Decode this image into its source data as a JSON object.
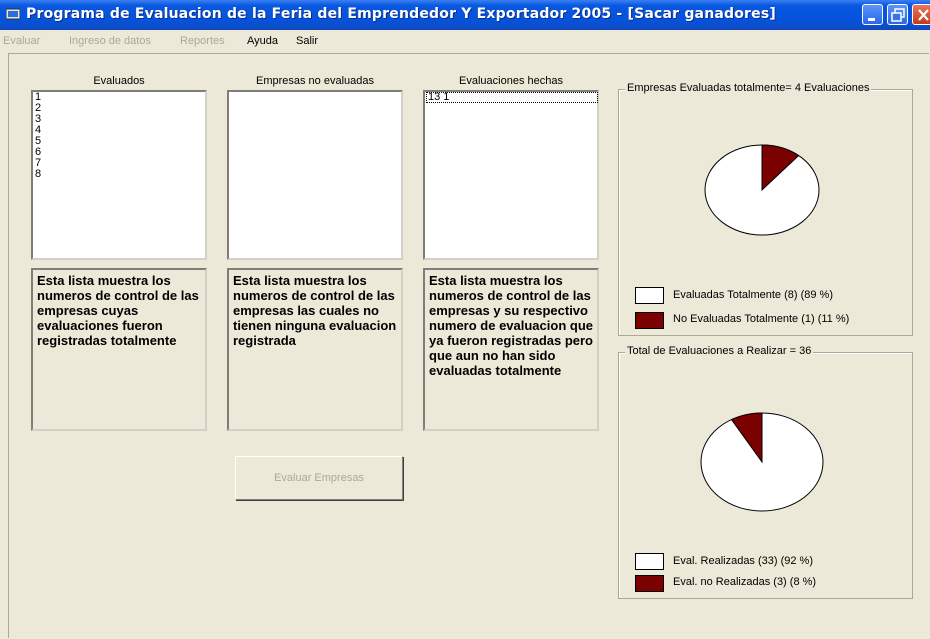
{
  "window": {
    "title": "Programa de Evaluacion de la Feria del Emprendedor Y Exportador 2005 - [Sacar ganadores]"
  },
  "menu": [
    {
      "label": "Evaluar",
      "enabled": false
    },
    {
      "label": "Ingreso de datos",
      "enabled": false
    },
    {
      "label": "Reportes",
      "enabled": false
    },
    {
      "label": "Ayuda",
      "enabled": true
    },
    {
      "label": "Salir",
      "enabled": true
    }
  ],
  "lists": {
    "evaluados": {
      "header": "Evaluados",
      "items": [
        "1",
        "2",
        "3",
        "4",
        "5",
        "6",
        "7",
        "8"
      ],
      "description": "Esta lista muestra los numeros de control de las empresas cuyas evaluaciones fueron registradas totalmente"
    },
    "no_evaluadas": {
      "header": "Empresas no evaluadas",
      "items": [],
      "description": "Esta lista muestra los numeros de control de las empresas las cuales no tienen ninguna evaluacion registrada"
    },
    "hechas": {
      "header": "Evaluaciones hechas",
      "items": [
        "13 1"
      ],
      "description": "Esta lista muestra los numeros de control de las empresas y su respectivo numero de evaluacion que ya fueron registradas pero que aun no han sido evaluadas totalmente"
    }
  },
  "button": {
    "evaluar_label": "Evaluar Empresas",
    "enabled": false
  },
  "groups": {
    "empresas": {
      "title": "Empresas Evaluadas totalmente= 4 Evaluaciones",
      "legend": [
        {
          "label": "Evaluadas Totalmente (8) (89 %)",
          "color": "#ffffff"
        },
        {
          "label": "No Evaluadas Totalmente (1) (11 %)",
          "color": "#7b0000"
        }
      ]
    },
    "evaluaciones": {
      "title": "Total de Evaluaciones a Realizar = 36",
      "legend": [
        {
          "label": "Eval. Realizadas (33) (92 %)",
          "color": "#ffffff"
        },
        {
          "label": "Eval. no Realizadas (3) (8 %)",
          "color": "#7b0000"
        }
      ]
    }
  },
  "chart_data": [
    {
      "type": "pie",
      "categories": [
        "Evaluadas Totalmente",
        "No Evaluadas Totalmente"
      ],
      "values": [
        8,
        1
      ],
      "colors": [
        "#ffffff",
        "#7b0000"
      ]
    },
    {
      "type": "pie",
      "categories": [
        "Eval. Realizadas",
        "Eval. no Realizadas"
      ],
      "values": [
        33,
        3
      ],
      "colors": [
        "#ffffff",
        "#7b0000"
      ]
    }
  ]
}
